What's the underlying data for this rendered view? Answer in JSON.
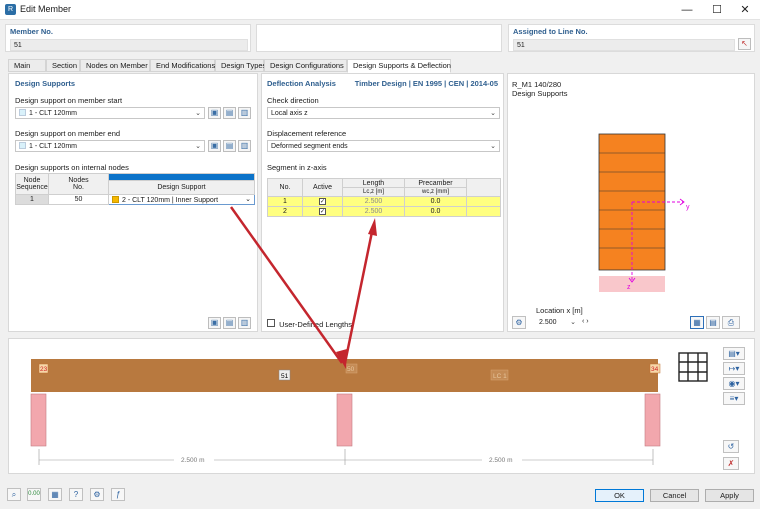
{
  "window": {
    "title": "Edit Member",
    "minimize": "—",
    "maximize": "☐",
    "close": "✕"
  },
  "member_no": {
    "label": "Member No.",
    "value": "51"
  },
  "assigned": {
    "label": "Assigned to Line No.",
    "value": "51"
  },
  "tabs": [
    "Main",
    "Section",
    "Nodes on Member",
    "End Modifications",
    "Design Types",
    "Design Configurations",
    "Design Supports & Deflection"
  ],
  "design_supports": {
    "title": "Design Supports",
    "start_label": "Design support on member start",
    "start_value": "1 - CLT   120mm",
    "end_label": "Design support on member end",
    "end_value": "1 - CLT   120mm",
    "internal_label": "Design supports on internal nodes",
    "table": {
      "col1": [
        "Node",
        "Sequence"
      ],
      "col2": [
        "Nodes",
        "No."
      ],
      "col3": "Design Support",
      "rows": [
        {
          "seq": "1",
          "node": "50",
          "support": "2 - CLT   120mm | Inner Support"
        }
      ]
    }
  },
  "deflection": {
    "title": "Deflection Analysis",
    "standard": "Timber Design | EN 1995 | CEN | 2014-05",
    "check_label": "Check direction",
    "check_value": "Local axis z",
    "disp_label": "Displacement reference",
    "disp_value": "Deformed segment ends",
    "segment_label": "Segment in z-axis",
    "table": {
      "headers": {
        "no": "No.",
        "active": "Active",
        "length": "Length",
        "length_sub": "Lc,z [m]",
        "precamber": "Precamber",
        "precamber_sub": "wc,z [mm]"
      },
      "rows": [
        {
          "no": "1",
          "length": "2.500",
          "precamber": "0.0"
        },
        {
          "no": "2",
          "length": "2.500",
          "precamber": "0.0"
        }
      ]
    },
    "user_defined": "User-Defined Lengths"
  },
  "preview": {
    "line1": "R_M1 140/280",
    "line2": "Design Supports",
    "axis_y": "y",
    "axis_z": "z",
    "location_label": "Location x [m]",
    "location_value": "2.500"
  },
  "beam": {
    "node_start": "23",
    "node_end": "34",
    "member_label": "51",
    "mid_label": "50",
    "lc_label": "LC 1",
    "dim1": "2.500 m",
    "dim2": "2.500 m"
  },
  "buttons": {
    "ok": "OK",
    "cancel": "Cancel",
    "apply": "Apply"
  },
  "colors": {
    "accent": "#0078d7",
    "beam": "#b8793f",
    "section": "#f58220",
    "support": "#f2a7ad",
    "highlight": "#ffff80",
    "arrow": "#c4262e"
  },
  "icons": [
    "search-icon",
    "units-icon",
    "table-icon",
    "help-icon",
    "settings-icon",
    "script-icon"
  ]
}
